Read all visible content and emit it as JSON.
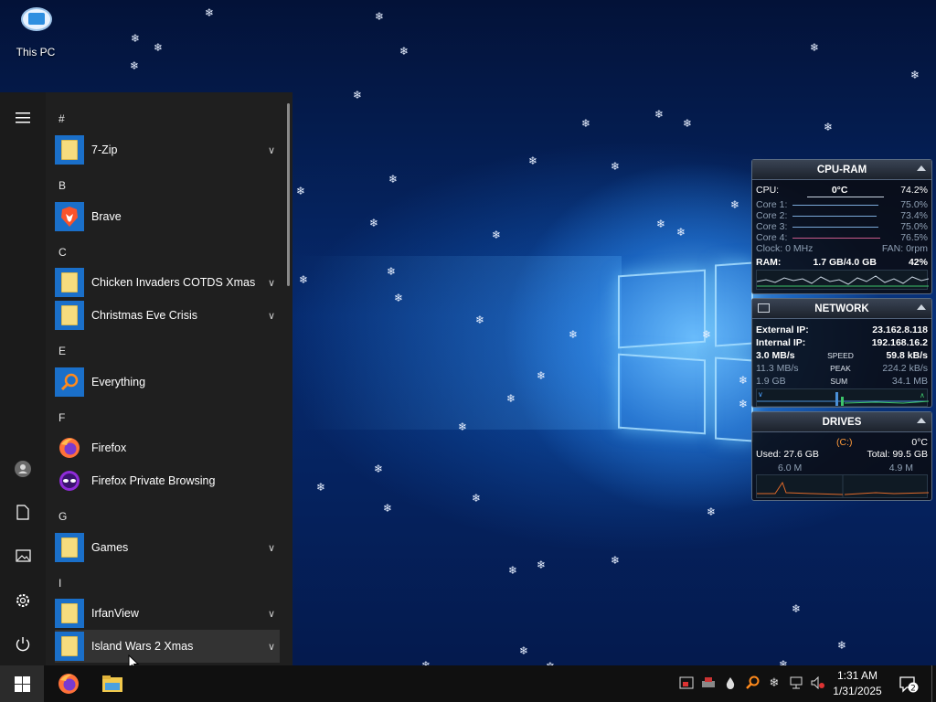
{
  "desktop": {
    "icons": [
      {
        "label": "This PC",
        "icon": "this-pc-icon"
      }
    ]
  },
  "start_menu": {
    "rail": [
      "hamburger-menu-icon",
      "user-avatar-icon",
      "documents-icon",
      "pictures-icon",
      "settings-gear-icon",
      "power-icon"
    ],
    "groups": [
      {
        "letter": "#",
        "apps": [
          {
            "name": "7-Zip",
            "icon": "folder-icon",
            "expandable": true
          }
        ]
      },
      {
        "letter": "B",
        "apps": [
          {
            "name": "Brave",
            "icon": "brave-icon",
            "expandable": false
          }
        ]
      },
      {
        "letter": "C",
        "apps": [
          {
            "name": "Chicken Invaders COTDS Xmas",
            "icon": "folder-icon",
            "expandable": true
          },
          {
            "name": "Christmas Eve Crisis",
            "icon": "folder-icon",
            "expandable": true
          }
        ]
      },
      {
        "letter": "E",
        "apps": [
          {
            "name": "Everything",
            "icon": "search-magnifier-icon",
            "expandable": false
          }
        ]
      },
      {
        "letter": "F",
        "apps": [
          {
            "name": "Firefox",
            "icon": "firefox-icon",
            "expandable": false
          },
          {
            "name": "Firefox Private Browsing",
            "icon": "firefox-private-icon",
            "expandable": false
          }
        ]
      },
      {
        "letter": "G",
        "apps": [
          {
            "name": "Games",
            "icon": "folder-icon",
            "expandable": true
          }
        ]
      },
      {
        "letter": "I",
        "apps": [
          {
            "name": "IrfanView",
            "icon": "folder-icon",
            "expandable": true
          },
          {
            "name": "Island Wars 2 Xmas",
            "icon": "folder-icon",
            "expandable": true,
            "hovered": true
          }
        ]
      }
    ]
  },
  "cpu_ram": {
    "title": "CPU-RAM",
    "cpu_label": "CPU:",
    "cpu_temp": "0°C",
    "cpu_percent": "74.2%",
    "cores": [
      {
        "label": "Core 1:",
        "value": "75.0%"
      },
      {
        "label": "Core 2:",
        "value": "73.4%"
      },
      {
        "label": "Core 3:",
        "value": "75.0%"
      },
      {
        "label": "Core 4:",
        "value": "76.5%"
      }
    ],
    "clock": "Clock: 0 MHz",
    "fan": "FAN: 0rpm",
    "ram_label": "RAM:",
    "ram_usage": "1.7 GB/4.0 GB",
    "ram_percent": "42%"
  },
  "network": {
    "title": "NETWORK",
    "external_ip_label": "External IP:",
    "external_ip": "23.162.8.118",
    "internal_ip_label": "Internal IP:",
    "internal_ip": "192.168.16.2",
    "speed_label": "SPEED",
    "speed_down": "3.0 MB/s",
    "speed_up": "59.8 kB/s",
    "peak_label": "PEAK",
    "peak_down": "11.3 MB/s",
    "peak_up": "224.2 kB/s",
    "sum_label": "SUM",
    "sum_down": "1.9 GB",
    "sum_up": "34.1 MB"
  },
  "drives": {
    "title": "DRIVES",
    "drive": "(C:)",
    "temp": "0°C",
    "used_label": "Used: 27.6 GB",
    "total_label": "Total: 99.5 GB",
    "read": "6.0 M",
    "write": "4.9 M"
  },
  "taskbar": {
    "pinned": [
      "windows-start-icon",
      "firefox-icon",
      "file-explorer-icon"
    ],
    "tray": [
      "task-manager-icon",
      "printer-icon",
      "water-drop-icon",
      "search-magnifier-icon",
      "snowflake-icon",
      "network-icon",
      "volume-muted-icon"
    ],
    "time": "1:31 AM",
    "date": "1/31/2025",
    "notification_count": "2"
  },
  "colors": {
    "accent": "#1a6fc9",
    "taskbar": "#101010",
    "start_bg": "#1f1f1f"
  }
}
